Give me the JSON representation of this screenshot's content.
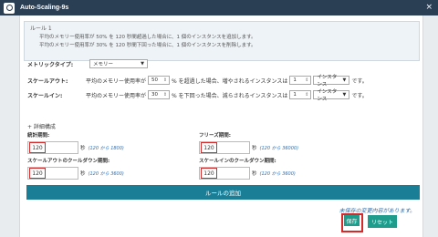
{
  "app": {
    "title": "Auto-Scaling-9s"
  },
  "rule_note": {
    "heading": "ルール 1",
    "lines": [
      "平均のメモリー使用率が 50% を 120 秒間超過した場合に、1 個のインスタンスを追加します。",
      "平均のメモリー使用率が 30% を 120 秒間下回った場合に、1 個のインスタンスを削除します。"
    ]
  },
  "metric": {
    "label": "メトリックタイプ:",
    "value": "メモリー"
  },
  "scale_out": {
    "label": "スケールアウト:",
    "prefix": "平均のメモリー使用率が",
    "percent": "50",
    "middle": "% を超過した場合、増やされるインスタンスは",
    "count": "1",
    "unit": "インスタンス",
    "suffix": "です。"
  },
  "scale_in": {
    "label": "スケールイン:",
    "prefix": "平均のメモリー使用率が",
    "percent": "30",
    "middle": "% を下回った場合、減らされるインスタンスは",
    "count": "1",
    "unit": "インスタンス",
    "suffix": "です。"
  },
  "detail_toggle": "+ 詳細構成",
  "fields": {
    "stat_period": {
      "title": "統計期間:",
      "value": "120",
      "unit": "秒",
      "hint": "(120 から 1800)"
    },
    "freeze_period": {
      "title": "フリーズ期間:",
      "value": "120",
      "unit": "秒",
      "hint": "(120 から 36000)"
    },
    "scale_out_cooldown": {
      "title": "スケールアウトのクールダウン期間:",
      "value": "120",
      "unit": "秒",
      "hint": "(120 から 3600)"
    },
    "scale_in_cooldown": {
      "title": "スケールインのクールダウン期間:",
      "value": "120",
      "unit": "秒",
      "hint": "(120 から 3600)"
    }
  },
  "add_rule_label": "ルールの追加",
  "unsaved_msg": "未保存の変更内容があります。",
  "buttons": {
    "save": "保存",
    "reset": "リセット"
  },
  "colors": {
    "header": "#2a3f54",
    "accent": "#1a7e96",
    "button": "#1f9c8c",
    "highlight": "#d62a2a"
  }
}
